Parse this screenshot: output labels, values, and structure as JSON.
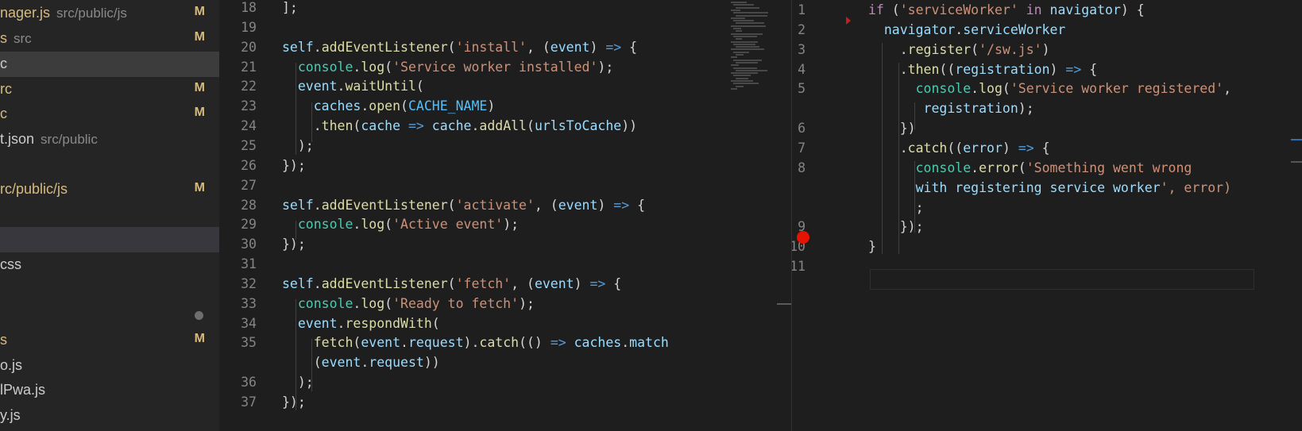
{
  "sidebar": {
    "items": [
      {
        "name": "nager.js",
        "path": "src/public/js",
        "badge": "M",
        "state": "modified"
      },
      {
        "name": "s",
        "path": "src",
        "badge": "M",
        "state": "modified"
      },
      {
        "name": "c",
        "path": "",
        "badge": "",
        "state": "selected"
      },
      {
        "name": "rc",
        "path": "",
        "badge": "M",
        "state": "modified"
      },
      {
        "name": "c",
        "path": "",
        "badge": "M",
        "state": "modified"
      },
      {
        "name": "t.json",
        "path": "src/public",
        "badge": "",
        "state": "normal"
      },
      {
        "name": "",
        "path": "",
        "badge": "",
        "state": "normal"
      },
      {
        "name": "rc/public/js",
        "path": "",
        "badge": "M",
        "state": "modified"
      },
      {
        "name": "",
        "path": "",
        "badge": "",
        "state": "normal"
      },
      {
        "name": "",
        "path": "",
        "badge": "",
        "state": "hover"
      },
      {
        "name": "css",
        "path": "",
        "badge": "",
        "state": "normal"
      },
      {
        "name": "",
        "path": "",
        "badge": "",
        "state": "normal"
      },
      {
        "name": "",
        "path": "",
        "badge": "dot",
        "state": "normal"
      },
      {
        "name": "s",
        "path": "",
        "badge": "M",
        "state": "modified"
      },
      {
        "name": "o.js",
        "path": "",
        "badge": "",
        "state": "normal"
      },
      {
        "name": "lPwa.js",
        "path": "",
        "badge": "",
        "state": "normal"
      },
      {
        "name": "y.js",
        "path": "",
        "badge": "",
        "state": "normal"
      }
    ]
  },
  "left_editor": {
    "lines": [
      {
        "n": "18",
        "code": "];"
      },
      {
        "n": "19",
        "code": ""
      },
      {
        "n": "20",
        "code": "self.addEventListener('install', (event) => {"
      },
      {
        "n": "21",
        "code": "  console.log('Service worker installed');"
      },
      {
        "n": "22",
        "code": "  event.waitUntil("
      },
      {
        "n": "23",
        "code": "    caches.open(CACHE_NAME)"
      },
      {
        "n": "24",
        "code": "    .then(cache => cache.addAll(urlsToCache))"
      },
      {
        "n": "25",
        "code": "  );"
      },
      {
        "n": "26",
        "code": "});"
      },
      {
        "n": "27",
        "code": ""
      },
      {
        "n": "28",
        "code": "self.addEventListener('activate', (event) => {"
      },
      {
        "n": "29",
        "code": "  console.log('Active event');"
      },
      {
        "n": "30",
        "code": "});"
      },
      {
        "n": "31",
        "code": ""
      },
      {
        "n": "32",
        "code": "self.addEventListener('fetch', (event) => {"
      },
      {
        "n": "33",
        "code": "  console.log('Ready to fetch');"
      },
      {
        "n": "34",
        "code": "  event.respondWith("
      },
      {
        "n": "35",
        "code": "    fetch(event.request).catch(() => caches.match"
      },
      {
        "n": "",
        "code": "    (event.request))"
      },
      {
        "n": "36",
        "code": "  );"
      },
      {
        "n": "37",
        "code": "});"
      }
    ]
  },
  "right_editor": {
    "lines": [
      {
        "n": "1",
        "code": "if ('serviceWorker' in navigator) {"
      },
      {
        "n": "2",
        "code": "  navigator.serviceWorker"
      },
      {
        "n": "3",
        "code": "    .register('/sw.js')"
      },
      {
        "n": "4",
        "code": "    .then((registration) => {"
      },
      {
        "n": "5",
        "code": "      console.log('Service worker registered',"
      },
      {
        "n": "",
        "code": "       registration);"
      },
      {
        "n": "6",
        "code": "    })"
      },
      {
        "n": "7",
        "code": "    .catch((error) => {"
      },
      {
        "n": "8",
        "code": "      console.error('Something went wrong"
      },
      {
        "n": "",
        "code": "      with registering service worker', error)"
      },
      {
        "n": "",
        "code": "      ;"
      },
      {
        "n": "9",
        "code": "    });"
      },
      {
        "n": "10",
        "code": "}"
      },
      {
        "n": "11",
        "code": ""
      }
    ]
  },
  "colors": {
    "background": "#1e1e1e",
    "sidebar": "#252526",
    "modified": "#d7ba7d",
    "breakpoint": "#e51400"
  }
}
